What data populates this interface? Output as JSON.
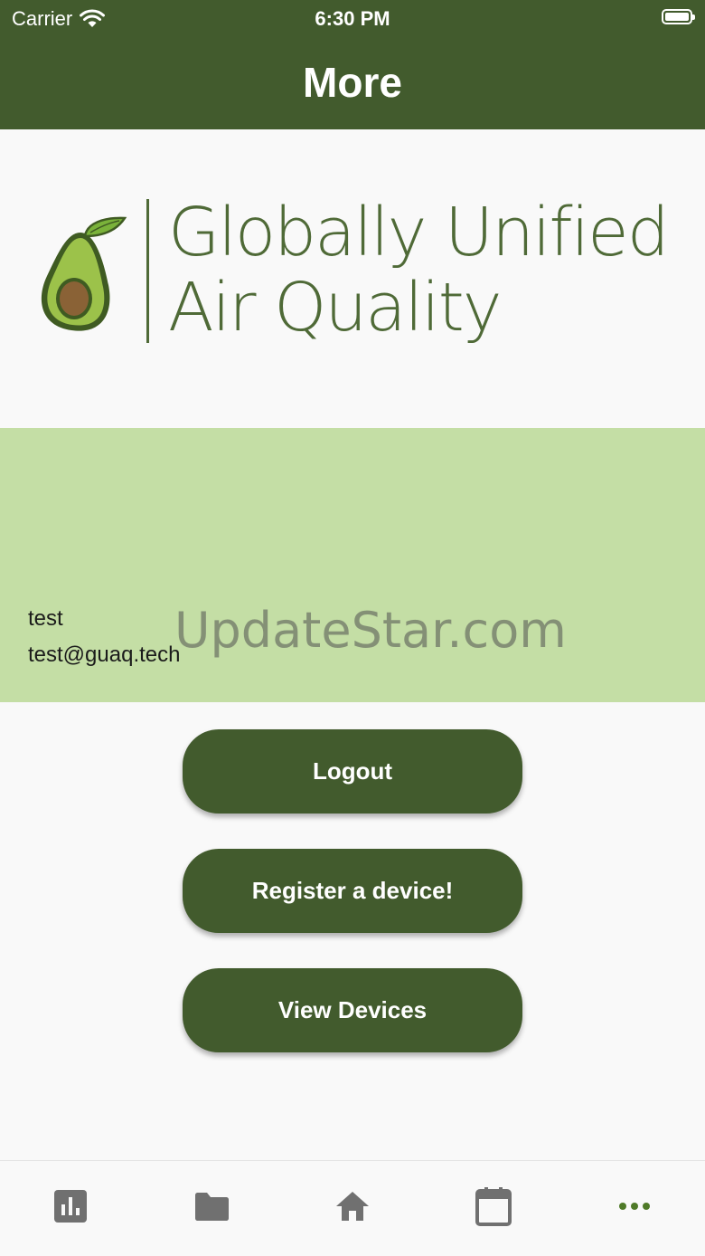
{
  "status_bar": {
    "carrier": "Carrier",
    "time": "6:30 PM"
  },
  "app_bar": {
    "title": "More"
  },
  "logo": {
    "line1": "Globally Unified",
    "line2": "Air Quality"
  },
  "profile": {
    "name": "test",
    "email": "test@guaq.tech"
  },
  "watermark": "UpdateStar.com",
  "buttons": {
    "logout": "Logout",
    "register": "Register a device!",
    "view_devices": "View Devices"
  },
  "tabs": [
    {
      "icon": "bar-chart-icon",
      "active": false
    },
    {
      "icon": "folder-icon",
      "active": false
    },
    {
      "icon": "home-icon",
      "active": false
    },
    {
      "icon": "calendar-icon",
      "active": false
    },
    {
      "icon": "more-dots-icon",
      "active": true
    }
  ],
  "colors": {
    "primary": "#425b2d",
    "profile_bg": "#c4dea5",
    "active_tab": "#4f7a28",
    "inactive_tab": "#707070"
  }
}
